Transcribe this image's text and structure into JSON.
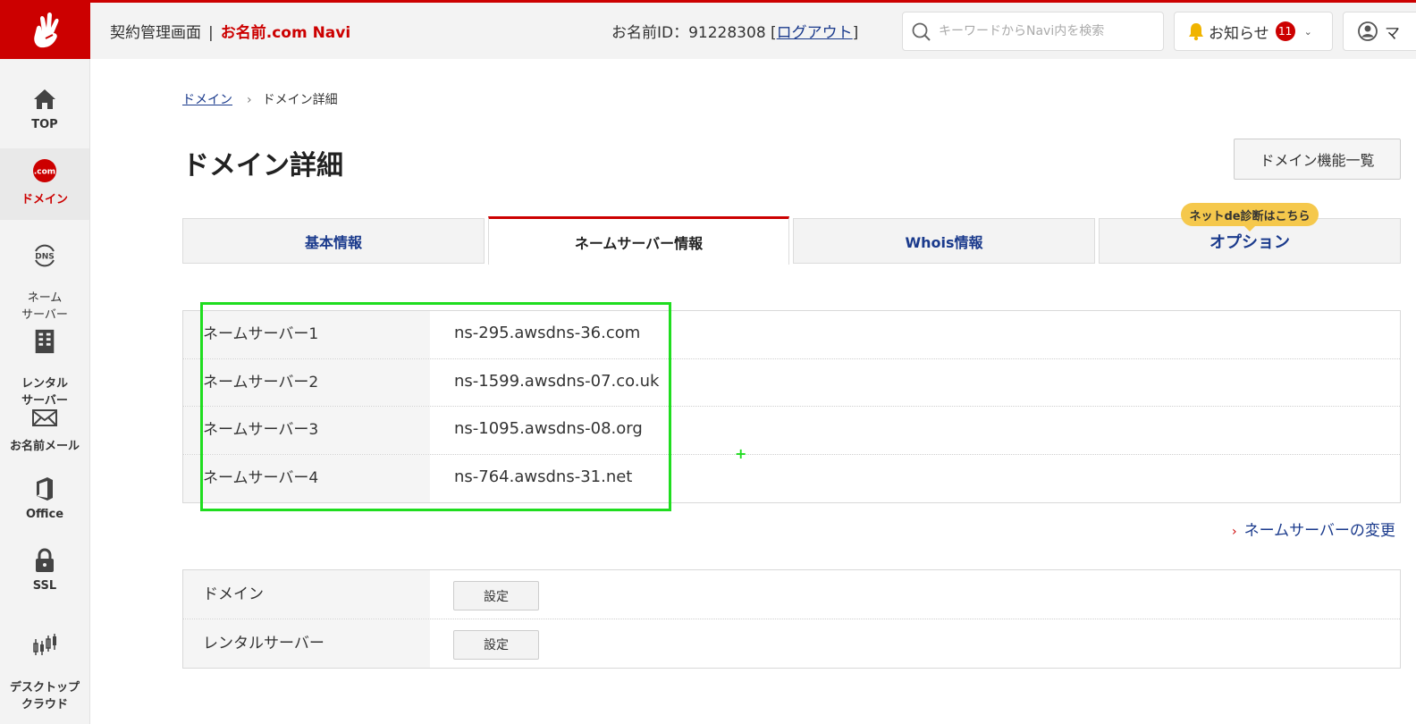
{
  "header": {
    "app_name": "契約管理画面",
    "separator": "|",
    "brand": "お名前.com Navi",
    "user_id_label": "お名前ID：91228308 [",
    "logout": "ログアウト",
    "user_id_suffix": "]",
    "search_placeholder": "キーワードからNavi内を検索",
    "notice_label": "お知らせ",
    "notice_count": "11",
    "account_label": "マ"
  },
  "sidebar": {
    "items": [
      {
        "label": "TOP",
        "icon": "home-icon"
      },
      {
        "label": "ドメイン",
        "icon": "dotcom-icon",
        "icon_text": ".com",
        "active": true
      },
      {
        "label": "ネーム\nサーバー",
        "icon": "dns-icon",
        "icon_text": "DNS"
      },
      {
        "label": "レンタル\nサーバー",
        "icon": "server-icon"
      },
      {
        "label": "お名前メール",
        "icon": "mail-icon"
      },
      {
        "label": "Office",
        "icon": "office-icon"
      },
      {
        "label": "SSL",
        "icon": "lock-icon"
      },
      {
        "label": "デスクトップ\nクラウド",
        "icon": "chart-icon"
      }
    ]
  },
  "breadcrumb": {
    "parent": "ドメイン",
    "current": "ドメイン詳細"
  },
  "page": {
    "title": "ドメイン詳細",
    "feature_button": "ドメイン機能一覧"
  },
  "tabs": [
    {
      "label": "基本情報"
    },
    {
      "label": "ネームサーバー情報",
      "active": true
    },
    {
      "label": "Whois情報"
    },
    {
      "label": "オプション"
    }
  ],
  "tab_bubble": "ネットde診断はこちら",
  "nameservers": [
    {
      "label": "ネームサーバー1",
      "value": "ns-295.awsdns-36.com"
    },
    {
      "label": "ネームサーバー2",
      "value": "ns-1599.awsdns-07.co.uk"
    },
    {
      "label": "ネームサーバー3",
      "value": "ns-1095.awsdns-08.org"
    },
    {
      "label": "ネームサーバー4",
      "value": "ns-764.awsdns-31.net"
    }
  ],
  "change_link": "ネームサーバーの変更",
  "settings": [
    {
      "label": "ドメイン",
      "button": "設定"
    },
    {
      "label": "レンタルサーバー",
      "button": "設定"
    }
  ],
  "colors": {
    "brand_red": "#cc0000",
    "link_blue": "#1a3a8c",
    "highlight_green": "#1fdd1f",
    "bubble_yellow": "#f5c84c"
  }
}
